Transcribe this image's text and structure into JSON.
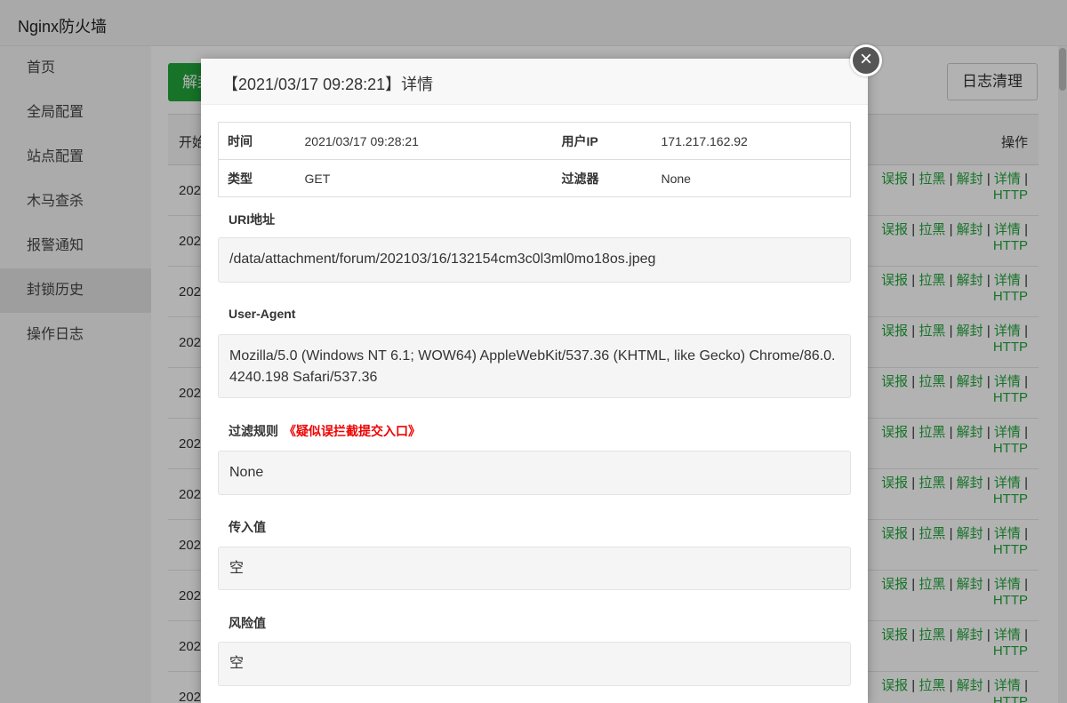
{
  "app": {
    "title": "Nginx防火墙"
  },
  "sidebar": {
    "items": [
      {
        "label": "首页"
      },
      {
        "label": "全局配置"
      },
      {
        "label": "站点配置"
      },
      {
        "label": "木马查杀"
      },
      {
        "label": "报警通知"
      },
      {
        "label": "封锁历史"
      },
      {
        "label": "操作日志"
      }
    ],
    "active_index": 5
  },
  "toolbar": {
    "unblock_label": "解封",
    "clear_label": "日志清理"
  },
  "table": {
    "header_first": "开始",
    "header_ops": "操作",
    "row_prefix": "202",
    "ops": {
      "misreport": "误报",
      "blacklist": "拉黑",
      "unblock": "解封",
      "detail": "详情",
      "http": "HTTP",
      "sep": "|"
    },
    "row_count": 11
  },
  "modal": {
    "title": "【2021/03/17 09:28:21】详情",
    "close_glyph": "×",
    "info": {
      "time_label": "时间",
      "time_value": "2021/03/17 09:28:21",
      "ip_label": "用户IP",
      "ip_value": "171.217.162.92",
      "type_label": "类型",
      "type_value": "GET",
      "filter_label": "过滤器",
      "filter_value": "None"
    },
    "uri": {
      "label": "URI地址",
      "value": "/data/attachment/forum/202103/16/132154cm3c0l3ml0mo18os.jpeg"
    },
    "ua": {
      "label": "User-Agent",
      "value": "Mozilla/5.0 (Windows NT 6.1; WOW64) AppleWebKit/537.36 (KHTML, like Gecko) Chrome/86.0.4240.198 Safari/537.36"
    },
    "rule": {
      "label": "过滤规则",
      "link": "《疑似误拦截提交入口》",
      "value": "None"
    },
    "input": {
      "label": "传入值",
      "value": "空"
    },
    "risk": {
      "label": "风险值",
      "value": "空"
    }
  },
  "colors": {
    "accent": "#20a53a",
    "warning": "#ee0000"
  }
}
